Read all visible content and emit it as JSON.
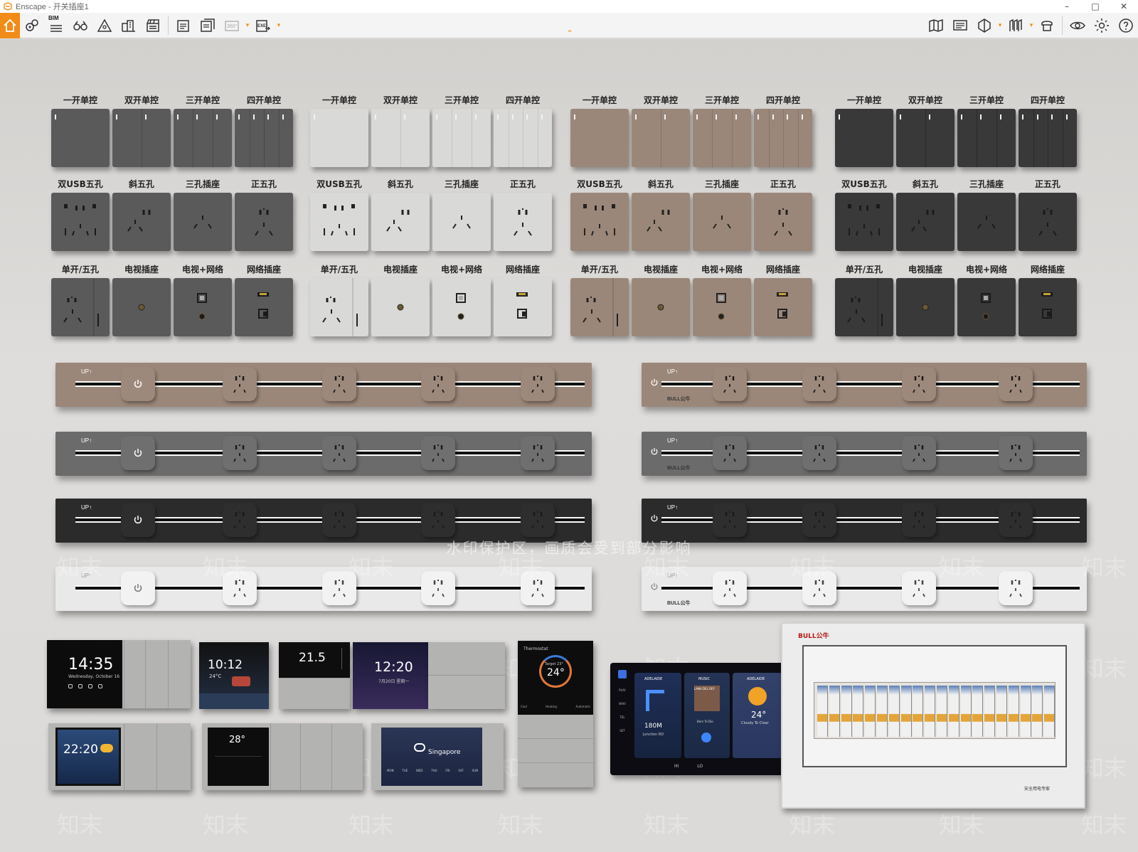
{
  "window": {
    "title": "Enscape - 开关插座1"
  },
  "toolbar": {
    "left_tools": [
      "home-icon",
      "location-pin-icon",
      "bim-list-icon",
      "binoculars-icon",
      "mountain-icon",
      "buildings-icon",
      "clapper-icon",
      "screenshot-icon",
      "batch-render-icon",
      "panorama-360-icon",
      "exe-export-icon"
    ],
    "bim_label": "BIM",
    "pano_label": "360°",
    "exe_label": "EXE",
    "right_tools": [
      "map-icon",
      "monitor-icon",
      "cube-icon",
      "atlas-icon",
      "asset-library-icon",
      "visibility-icon",
      "settings-icon",
      "help-icon"
    ],
    "accent": "#f28c18"
  },
  "switch_groups": [
    {
      "color": "#5a5a5a",
      "seam": "#4a4a4a",
      "row1": [
        "一开单控",
        "双开单控",
        "三开单控",
        "四开单控"
      ],
      "row2": [
        "双USB五孔",
        "斜五孔",
        "三孔插座",
        "正五孔"
      ],
      "row3": [
        "单开/五孔",
        "电视插座",
        "电视+网络",
        "网络插座"
      ]
    },
    {
      "color": "#d9d9d8",
      "seam": "#c4c4c3",
      "row1": [
        "一开单控",
        "双开单控",
        "三开单控",
        "四开单控"
      ],
      "row2": [
        "双USB五孔",
        "斜五孔",
        "三孔插座",
        "正五孔"
      ],
      "row3": [
        "单开/五孔",
        "电视插座",
        "电视+网络",
        "网络插座"
      ]
    },
    {
      "color": "#9b8779",
      "seam": "#85746a",
      "row1": [
        "一开单控",
        "双开单控",
        "三开单控",
        "四开单控"
      ],
      "row2": [
        "双USB五孔",
        "斜五孔",
        "三孔插座",
        "正五孔"
      ],
      "row3": [
        "单开/五孔",
        "电视插座",
        "电视+网络",
        "网络插座"
      ]
    },
    {
      "color": "#393939",
      "seam": "#2a2a2a",
      "row1": [
        "一开单控",
        "双开单控",
        "三开单控",
        "四开单控"
      ],
      "row2": [
        "双USB五孔",
        "斜五孔",
        "三孔插座",
        "正五孔"
      ],
      "row3": [
        "单开/五孔",
        "电视插座",
        "电视+网络",
        "网络插座"
      ]
    }
  ],
  "track_strips": [
    {
      "color": "#9b8779",
      "module": "#9d897b"
    },
    {
      "color": "#6b6b6b",
      "module": "#6f6f6f"
    },
    {
      "color": "#2b2b2b",
      "module": "#2e2e2e"
    },
    {
      "color": "#e9e9e9",
      "module": "#f2f2f2"
    }
  ],
  "strip_brand": "UP↑",
  "strip_brand_logo": "BULL公牛",
  "watermark_text": "水印保护区，画质会受到部分影响",
  "watermark_glyph": "知末",
  "smart_panels": {
    "p1_time": "14:35",
    "p1_date": "Wednesday, October 16",
    "p2_time": "10:12",
    "p2_temp": "24°C",
    "p3_temp": "21.5",
    "p4_time": "12:20",
    "p4_date": "7月20日  星期一",
    "thermostat_title": "Thermostat",
    "thermostat_target": "Target 23°",
    "thermostat_value": "24°",
    "thermostat_modes": [
      "Cool",
      "Heating",
      "Automatic"
    ],
    "p5_time": "22:20",
    "p6_temp": "28°",
    "p7_city": "Singapore",
    "p7_days": [
      "MON",
      "TUE",
      "WED",
      "THU",
      "FRI",
      "SAT",
      "SUN"
    ],
    "car": {
      "side": [
        "PLAY",
        "NAVI",
        "TEL",
        "SET"
      ],
      "card1_title": "ADELAIDE",
      "card1_dist": "180M",
      "card1_road": "Junction RD",
      "card2_title": "MUSIC",
      "card2_album": "LANA DEL REY",
      "card2_song": "Born To Die",
      "card3_title": "ADELAIDE",
      "card3_temp": "24°",
      "card3_desc": "Cloudy To Clear",
      "bottom": [
        "HI",
        "LO"
      ]
    },
    "breaker_brand": "BULL公牛",
    "breaker_slogan": "安全用电专家"
  }
}
